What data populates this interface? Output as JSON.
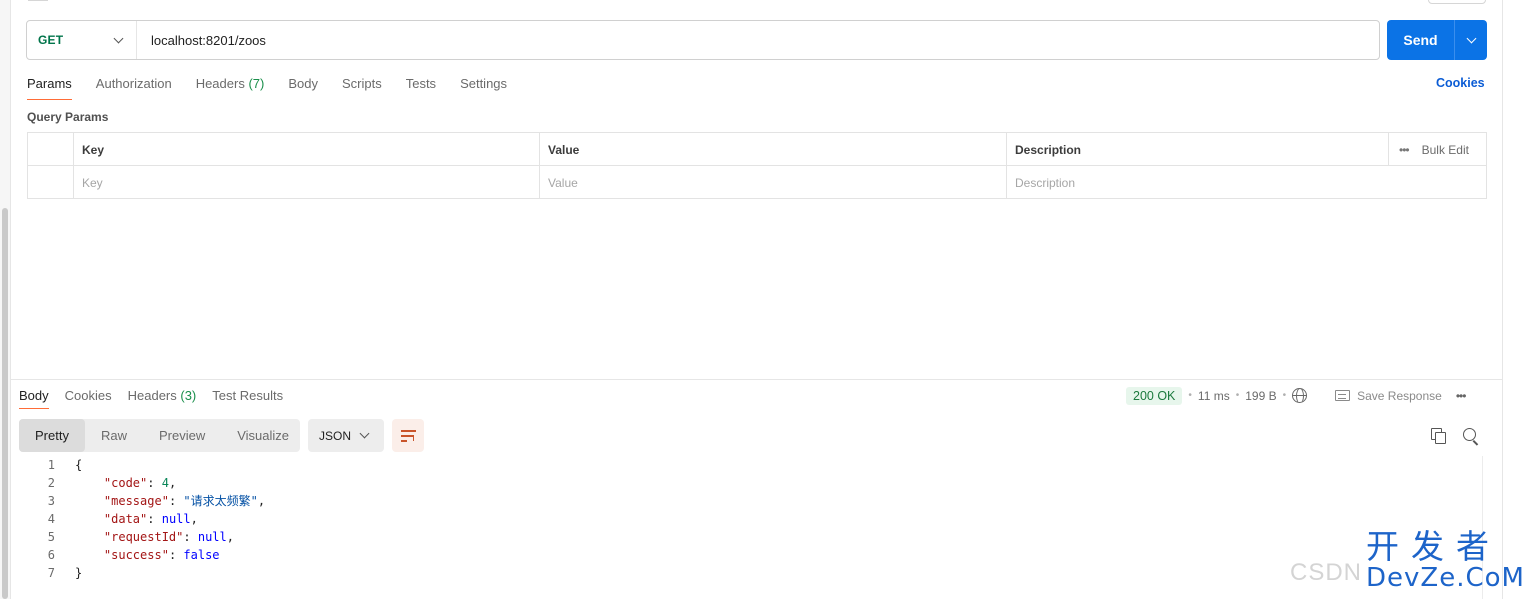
{
  "request": {
    "method": "GET",
    "url": "localhost:8201/zoos",
    "send_label": "Send"
  },
  "request_tabs": [
    {
      "label": "Params",
      "count": ""
    },
    {
      "label": "Authorization",
      "count": ""
    },
    {
      "label": "Headers",
      "count": "(7)"
    },
    {
      "label": "Body",
      "count": ""
    },
    {
      "label": "Scripts",
      "count": ""
    },
    {
      "label": "Tests",
      "count": ""
    },
    {
      "label": "Settings",
      "count": ""
    }
  ],
  "cookies_link": "Cookies",
  "query_params": {
    "title": "Query Params",
    "headers": [
      "Key",
      "Value",
      "Description"
    ],
    "placeholders": [
      "Key",
      "Value",
      "Description"
    ],
    "bulk_edit": "Bulk Edit",
    "more": "•••"
  },
  "response_tabs": [
    {
      "label": "Body",
      "count": ""
    },
    {
      "label": "Cookies",
      "count": ""
    },
    {
      "label": "Headers",
      "count": "(3)"
    },
    {
      "label": "Test Results",
      "count": ""
    }
  ],
  "response_status": {
    "status": "200 OK",
    "time": "11 ms",
    "size": "199 B",
    "save_label": "Save Response",
    "dot": "•",
    "more": "•••"
  },
  "view_modes": [
    "Pretty",
    "Raw",
    "Preview",
    "Visualize"
  ],
  "format": "JSON",
  "code_lines": [
    {
      "n": "1",
      "text": "{"
    },
    {
      "n": "2",
      "key": "\"code\"",
      "sep": ": ",
      "val": "4",
      "type": "n",
      "tail": ","
    },
    {
      "n": "3",
      "key": "\"message\"",
      "sep": ": ",
      "val": "\"请求太频繁\"",
      "type": "s",
      "tail": ","
    },
    {
      "n": "4",
      "key": "\"data\"",
      "sep": ": ",
      "val": "null",
      "type": "kw",
      "tail": ","
    },
    {
      "n": "5",
      "key": "\"requestId\"",
      "sep": ": ",
      "val": "null",
      "type": "kw",
      "tail": ","
    },
    {
      "n": "6",
      "key": "\"success\"",
      "sep": ": ",
      "val": "false",
      "type": "kw",
      "tail": ""
    },
    {
      "n": "7",
      "text": "}"
    }
  ],
  "watermark": {
    "csdn": "CSDN",
    "dev_cn": "开发者",
    "dev_en": "DevZe.CoM"
  },
  "colors": {
    "accent": "#ff6c37",
    "send": "#0b73e6",
    "method_get": "#00744a",
    "status_ok": "#1b7a3d"
  }
}
